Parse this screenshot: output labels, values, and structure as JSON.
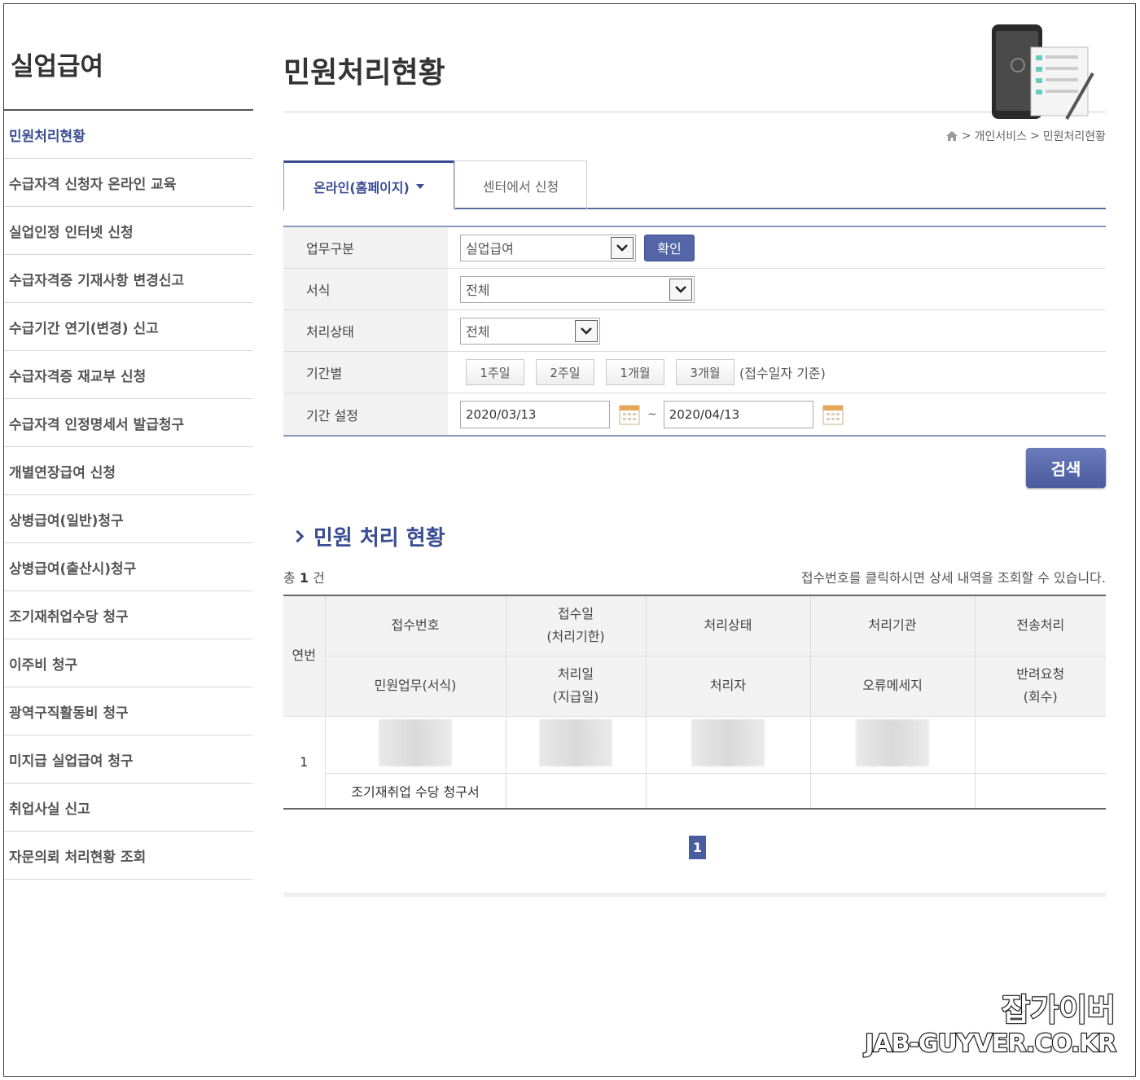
{
  "sidebar": {
    "title": "실업급여",
    "items": [
      {
        "label": "민원처리현황",
        "active": true
      },
      {
        "label": "수급자격 신청자 온라인 교육"
      },
      {
        "label": "실업인정 인터넷 신청"
      },
      {
        "label": "수급자격증 기재사항 변경신고"
      },
      {
        "label": "수급기간 연기(변경) 신고"
      },
      {
        "label": "수급자격증 재교부 신청"
      },
      {
        "label": "수급자격 인정명세서 발급청구"
      },
      {
        "label": "개별연장급여 신청"
      },
      {
        "label": "상병급여(일반)청구"
      },
      {
        "label": "상병급여(출산시)청구"
      },
      {
        "label": "조기재취업수당 청구"
      },
      {
        "label": "이주비 청구"
      },
      {
        "label": "광역구직활동비 청구"
      },
      {
        "label": "미지급 실업급여 청구"
      },
      {
        "label": "취업사실 신고"
      },
      {
        "label": "자문의뢰 처리현황 조회"
      }
    ]
  },
  "header": {
    "title": "민원처리현황",
    "breadcrumb": [
      "개인서비스",
      "민원처리현황"
    ],
    "breadcrumb_sep": ">"
  },
  "tabs": {
    "active_label": "온라인(홈페이지)",
    "inactive_label": "센터에서 신청"
  },
  "form": {
    "business_label": "업무구분",
    "business_value": "실업급여",
    "confirm_label": "확인",
    "format_label": "서식",
    "format_value": "전체",
    "status_label": "처리상태",
    "status_value": "전체",
    "period_label": "기간별",
    "period_buttons": [
      "1주일",
      "2주일",
      "1개월",
      "3개월"
    ],
    "period_note": "(접수일자 기준)",
    "range_label": "기간 설정",
    "date_from": "2020/03/13",
    "date_sep": "~",
    "date_to": "2020/04/13",
    "search_label": "검색"
  },
  "results": {
    "section_title": "민원 처리 현황",
    "total_prefix": "총",
    "total_count": "1",
    "total_suffix": "건",
    "hint": "접수번호를 클릭하시면 상세 내역을 조회할 수 있습니다.",
    "headers": {
      "seq": "연번",
      "receipt_no": "접수번호",
      "receipt_date": "접수일",
      "receipt_deadline": "(처리기한)",
      "status": "처리상태",
      "agency": "처리기관",
      "transmit": "전송처리",
      "task": "민원업무(서식)",
      "process_date": "처리일",
      "pay_date": "(지급일)",
      "handler": "처리자",
      "error_msg": "오류메세지",
      "return_req": "반려요청",
      "count": "(회수)"
    },
    "rows": [
      {
        "seq": "1",
        "task": "조기재취업 수당 청구서"
      }
    ]
  },
  "pagination": {
    "current": "1"
  },
  "watermark": {
    "line1": "잡가이버",
    "line2": "JAB-GUYVER.CO.KR"
  },
  "colors": {
    "accent": "#3a4d93",
    "button": "#5466a8",
    "label_bg": "#f2f2f2"
  }
}
